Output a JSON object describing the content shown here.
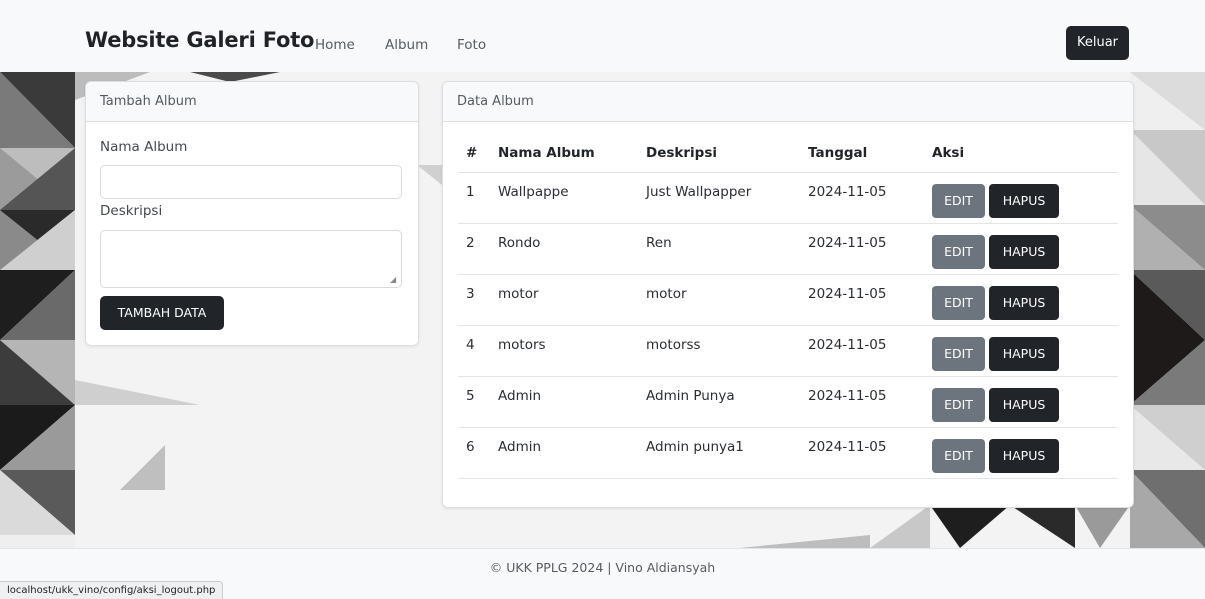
{
  "navbar": {
    "brand": "Website Galeri Foto",
    "links": [
      "Home",
      "Album",
      "Foto"
    ],
    "logout_label": "Keluar"
  },
  "add_form": {
    "header": "Tambah Album",
    "name_label": "Nama Album",
    "name_value": "",
    "desc_label": "Deskripsi",
    "desc_value": "",
    "submit_label": "TAMBAH DATA"
  },
  "album_table": {
    "header": "Data Album",
    "columns": [
      "#",
      "Nama Album",
      "Deskripsi",
      "Tanggal",
      "Aksi"
    ],
    "rows": [
      {
        "no": "1",
        "name": "Wallpappe",
        "desc": "Just Wallpapper",
        "date": "2024-11-05"
      },
      {
        "no": "2",
        "name": "Rondo",
        "desc": "Ren",
        "date": "2024-11-05"
      },
      {
        "no": "3",
        "name": "motor",
        "desc": "motor",
        "date": "2024-11-05"
      },
      {
        "no": "4",
        "name": "motors",
        "desc": "motorss",
        "date": "2024-11-05"
      },
      {
        "no": "5",
        "name": "Admin",
        "desc": "Admin Punya",
        "date": "2024-11-05"
      },
      {
        "no": "6",
        "name": "Admin",
        "desc": "Admin punya1",
        "date": "2024-11-05"
      }
    ],
    "edit_label": "EDIT",
    "delete_label": "HAPUS"
  },
  "footer": {
    "text": "© UKK PPLG 2024 | Vino Aldiansyah"
  },
  "status_url": "localhost/ukk_vino/config/aksi_logout.php",
  "colors": {
    "dark": "#212529",
    "secondary": "#6c757d",
    "light": "#f8f9fa"
  }
}
